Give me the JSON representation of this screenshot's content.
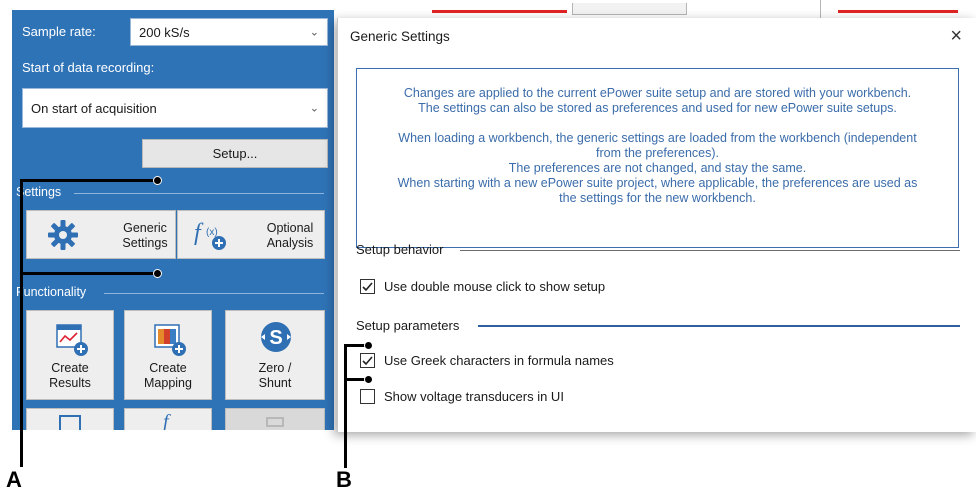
{
  "left_panel": {
    "sample_rate_label": "Sample rate:",
    "sample_rate_value": "200 kS/s",
    "start_recording_label": "Start of data recording:",
    "start_recording_value": "On start of acquisition",
    "setup_button": "Setup...",
    "settings_section": "Settings",
    "generic_settings_line1": "Generic",
    "generic_settings_line2": "Settings",
    "optional_analysis_line1": "Optional",
    "optional_analysis_line2": "Analysis",
    "functionality_section": "Functionality",
    "create_results_line1": "Create",
    "create_results_line2": "Results",
    "create_mapping_line1": "Create",
    "create_mapping_line2": "Mapping",
    "zero_shunt_line1": "Zero /",
    "zero_shunt_line2": "Shunt",
    "formula_glyph": "f",
    "formula_sub": "(x)"
  },
  "dialog": {
    "title": "Generic Settings",
    "close_glyph": "×",
    "info_lines": [
      "Changes are applied to the current ePower suite setup and are stored with your workbench.",
      "The settings can also be stored as preferences and used for new ePower suite setups.",
      "",
      "When loading a workbench, the generic settings are loaded from the workbench (independent",
      "from the preferences).",
      "The preferences are not changed, and stay the same.",
      "When starting with a new ePower suite project, where applicable, the preferences are used as",
      "the settings for the new workbench."
    ],
    "setup_behavior_header": "Setup behavior",
    "double_click_label": "Use double mouse click to show setup",
    "double_click_checked": true,
    "setup_parameters_header": "Setup parameters",
    "greek_label": "Use Greek characters in formula names",
    "greek_checked": true,
    "voltage_label": "Show voltage transducers in UI",
    "voltage_checked": false
  },
  "annotations": {
    "label_a": "A",
    "label_b": "B"
  },
  "colors": {
    "panel_blue": "#2f73b7",
    "info_text": "#3a6caa",
    "accent_red": "#e02424"
  }
}
